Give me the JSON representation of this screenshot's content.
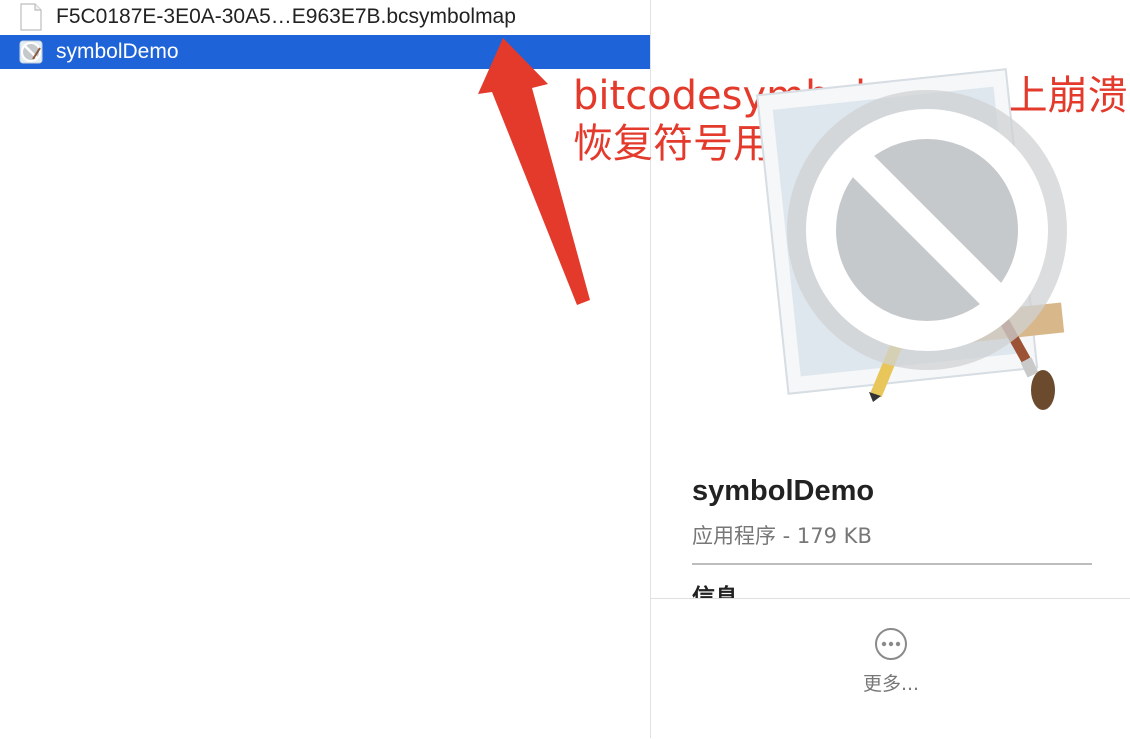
{
  "file_list": {
    "items": [
      {
        "name": "F5C0187E-3E0A-30A5…E963E7B.bcsymbolmap",
        "icon": "document-icon",
        "selected": false
      },
      {
        "name": "symbolDemo",
        "icon": "app-prohibited-icon",
        "selected": true
      }
    ]
  },
  "annotation": {
    "text": "bitcodesymbolmap 线上崩溃恢复符号用",
    "color": "#e33a2c"
  },
  "preview": {
    "app_name": "symbolDemo",
    "kind_size": "应用程序 - 179 KB",
    "info_heading": "信息",
    "more_label": "更多..."
  },
  "colors": {
    "selection": "#1f63d8",
    "annotation_red": "#e33a2c"
  }
}
